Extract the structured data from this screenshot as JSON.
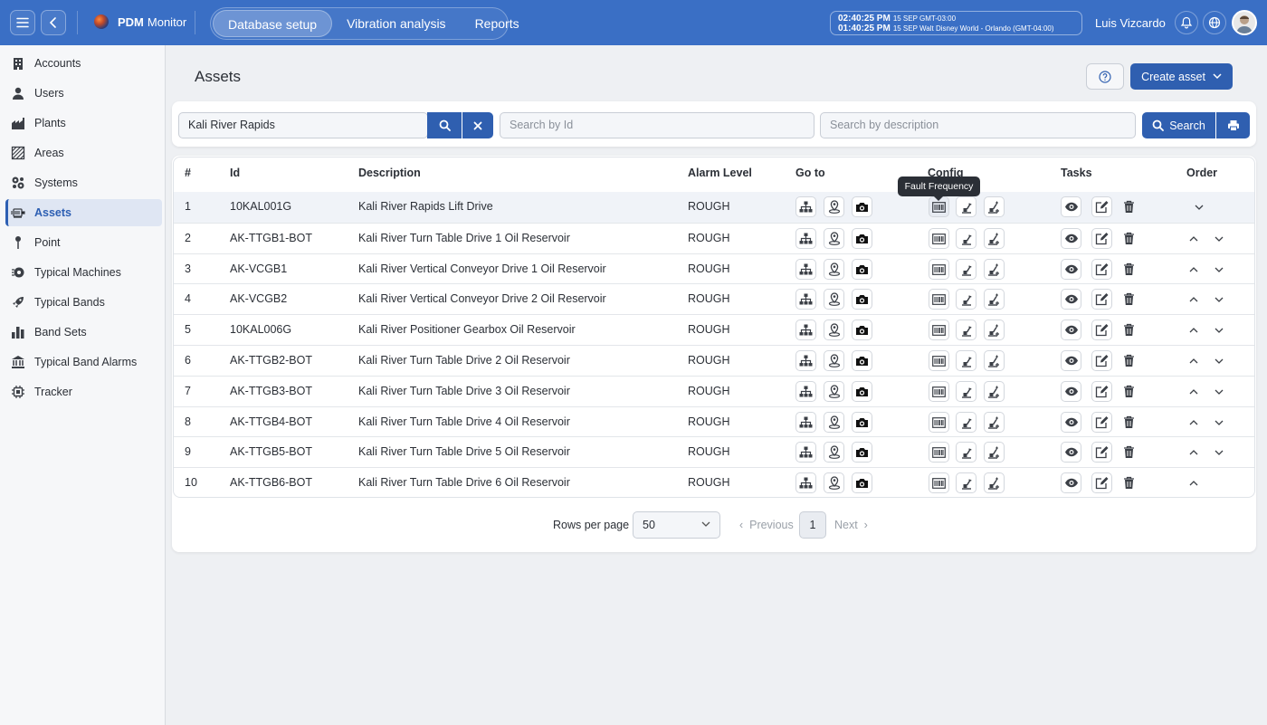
{
  "app": {
    "name_bold": "PDM",
    "name_rest": "Monitor"
  },
  "nav": {
    "tabs": [
      {
        "label": "Database setup",
        "active": true
      },
      {
        "label": "Vibration analysis",
        "active": false
      },
      {
        "label": "Reports",
        "active": false
      }
    ]
  },
  "clock": {
    "line1_time": "02:40:25 PM",
    "line1_detail": "15 SEP  GMT-03:00",
    "line2_time": "01:40:25 PM",
    "line2_detail": "15 SEP  Walt Disney World - Orlando (GMT-04:00)"
  },
  "user": {
    "name": "Luis Vizcardo"
  },
  "sidebar": {
    "items": [
      {
        "label": "Accounts",
        "icon": "building-icon"
      },
      {
        "label": "Users",
        "icon": "user-icon"
      },
      {
        "label": "Plants",
        "icon": "factory-icon"
      },
      {
        "label": "Areas",
        "icon": "hatched-area-icon"
      },
      {
        "label": "Systems",
        "icon": "gears-icon"
      },
      {
        "label": "Assets",
        "icon": "motor-icon",
        "active": true
      },
      {
        "label": "Point",
        "icon": "pin-icon"
      },
      {
        "label": "Typical Machines",
        "icon": "machine-gear-icon"
      },
      {
        "label": "Typical Bands",
        "icon": "rocket-icon"
      },
      {
        "label": "Band Sets",
        "icon": "bar-chart-icon"
      },
      {
        "label": "Typical Band Alarms",
        "icon": "bank-icon"
      },
      {
        "label": "Tracker",
        "icon": "chip-icon"
      }
    ]
  },
  "page": {
    "title": "Assets",
    "create_label": "Create asset"
  },
  "search": {
    "plant_value": "Kali River Rapids",
    "id_placeholder": "Search by Id",
    "desc_placeholder": "Search by description",
    "search_label": "Search"
  },
  "table": {
    "headers": {
      "num": "#",
      "id": "Id",
      "description": "Description",
      "alarm": "Alarm Level",
      "goto": "Go to",
      "config": "Config",
      "tasks": "Tasks",
      "order": "Order"
    },
    "rows": [
      {
        "num": "1",
        "id": "10KAL001G",
        "description": "Kali River Rapids Lift Drive",
        "alarm": "ROUGH"
      },
      {
        "num": "2",
        "id": "AK-TTGB1-BOT",
        "description": "Kali River Turn Table Drive 1 Oil Reservoir",
        "alarm": "ROUGH"
      },
      {
        "num": "3",
        "id": "AK-VCGB1",
        "description": "Kali River Vertical Conveyor Drive 1 Oil Reservoir",
        "alarm": "ROUGH"
      },
      {
        "num": "4",
        "id": "AK-VCGB2",
        "description": "Kali River Vertical Conveyor Drive 2 Oil Reservoir",
        "alarm": "ROUGH"
      },
      {
        "num": "5",
        "id": "10KAL006G",
        "description": "Kali River Positioner Gearbox Oil Reservoir",
        "alarm": "ROUGH"
      },
      {
        "num": "6",
        "id": "AK-TTGB2-BOT",
        "description": "Kali River Turn Table Drive 2 Oil Reservoir",
        "alarm": "ROUGH"
      },
      {
        "num": "7",
        "id": "AK-TTGB3-BOT",
        "description": "Kali River Turn Table Drive 3 Oil Reservoir",
        "alarm": "ROUGH"
      },
      {
        "num": "8",
        "id": "AK-TTGB4-BOT",
        "description": "Kali River Turn Table Drive 4 Oil Reservoir",
        "alarm": "ROUGH"
      },
      {
        "num": "9",
        "id": "AK-TTGB5-BOT",
        "description": "Kali River Turn Table Drive 5 Oil Reservoir",
        "alarm": "ROUGH"
      },
      {
        "num": "10",
        "id": "AK-TTGB6-BOT",
        "description": "Kali River Turn Table Drive 6 Oil Reservoir",
        "alarm": "ROUGH"
      }
    ]
  },
  "tooltip": {
    "text": "Fault Frequency"
  },
  "pagination": {
    "rows_label": "Rows per page",
    "rows_value": "50",
    "prev": "Previous",
    "page": "1",
    "next": "Next"
  }
}
